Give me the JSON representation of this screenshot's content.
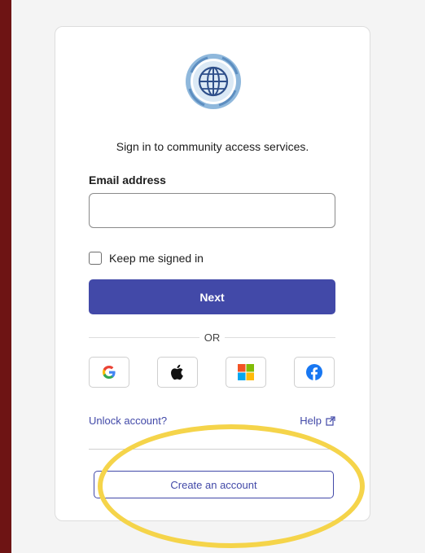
{
  "signin": {
    "intro": "Sign in to community access services.",
    "email_label": "Email address",
    "email_value": "",
    "remember_label": "Keep me signed in",
    "next_label": "Next",
    "or_label": "OR",
    "social": [
      "google-icon",
      "apple-icon",
      "microsoft-icon",
      "facebook-icon"
    ],
    "unlock_label": "Unlock account?",
    "help_label": "Help",
    "create_label": "Create an account"
  },
  "colors": {
    "background": "#6e1414",
    "accent": "#4249a8",
    "highlight": "#f5d44a"
  }
}
